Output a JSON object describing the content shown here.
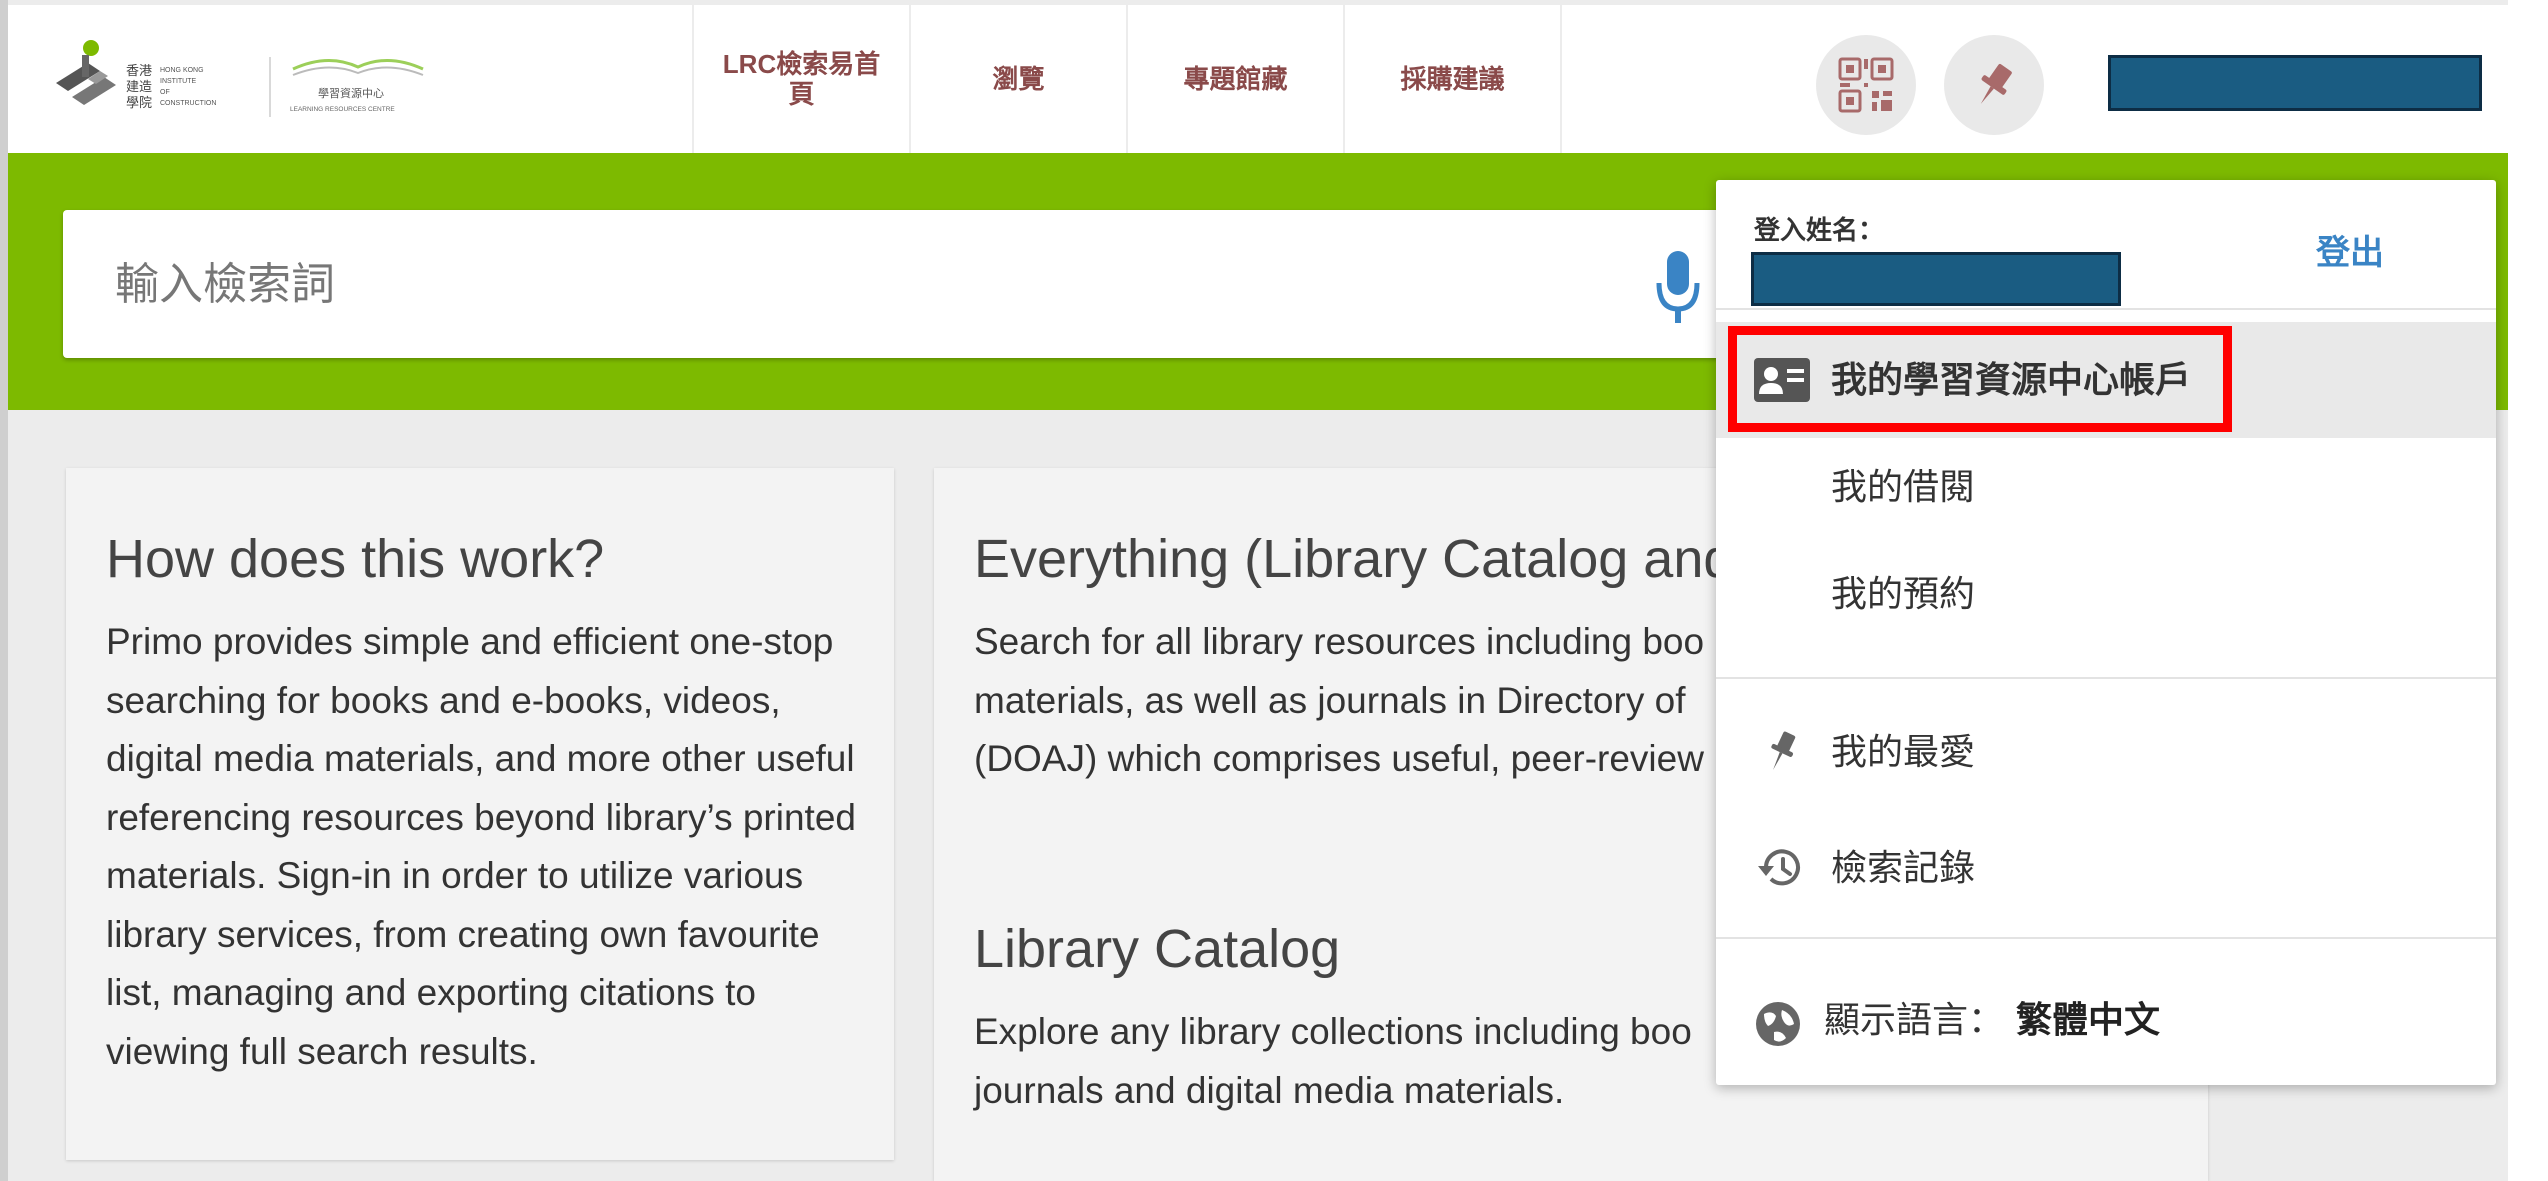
{
  "logo": {
    "chinese_name": "香港建造學院",
    "english_name": [
      "HONG KONG",
      "INSTITUTE",
      "OF",
      "CONSTRUCTION"
    ],
    "lrc_chinese": "學習資源中心",
    "lrc_english": "LEARNING RESOURCES CENTRE"
  },
  "nav": {
    "home_line1": "LRC檢索易首",
    "home_line2": "頁",
    "browse": "瀏覽",
    "collections": "專題館藏",
    "purchase": "採購建議"
  },
  "search": {
    "placeholder": "輸入檢索詞"
  },
  "cards": {
    "how": {
      "title": "How does this work?",
      "body": "Primo provides simple and efficient one-stop searching for books and e-books, videos, digital media materials, and more other useful referencing resources beyond library’s printed materials. Sign-in in order to utilize various library services, from creating own favourite list, managing and exporting citations to viewing full search results."
    },
    "everything": {
      "title": "Everything (Library Catalog and",
      "body": "Search for all library resources including boo materials, as well as journals in Directory of (DOAJ) which comprises useful, peer-review"
    },
    "catalog": {
      "title": "Library Catalog",
      "body": "Explore any library collections including boo journals and digital media materials."
    }
  },
  "menu": {
    "login_label": "登入姓名：",
    "logout": "登出",
    "account": "我的學習資源中心帳戶",
    "loans": "我的借閱",
    "requests": "我的預約",
    "favorites": "我的最愛",
    "history": "檢索記錄",
    "language_label": "顯示語言：",
    "language_value": "繁體中文"
  },
  "colors": {
    "brand_green": "#7dba00",
    "nav_text": "#8a4a4a",
    "redacted_block": "#1a5c82",
    "logout_link": "#3a84c5",
    "highlight": "#ff0000"
  }
}
